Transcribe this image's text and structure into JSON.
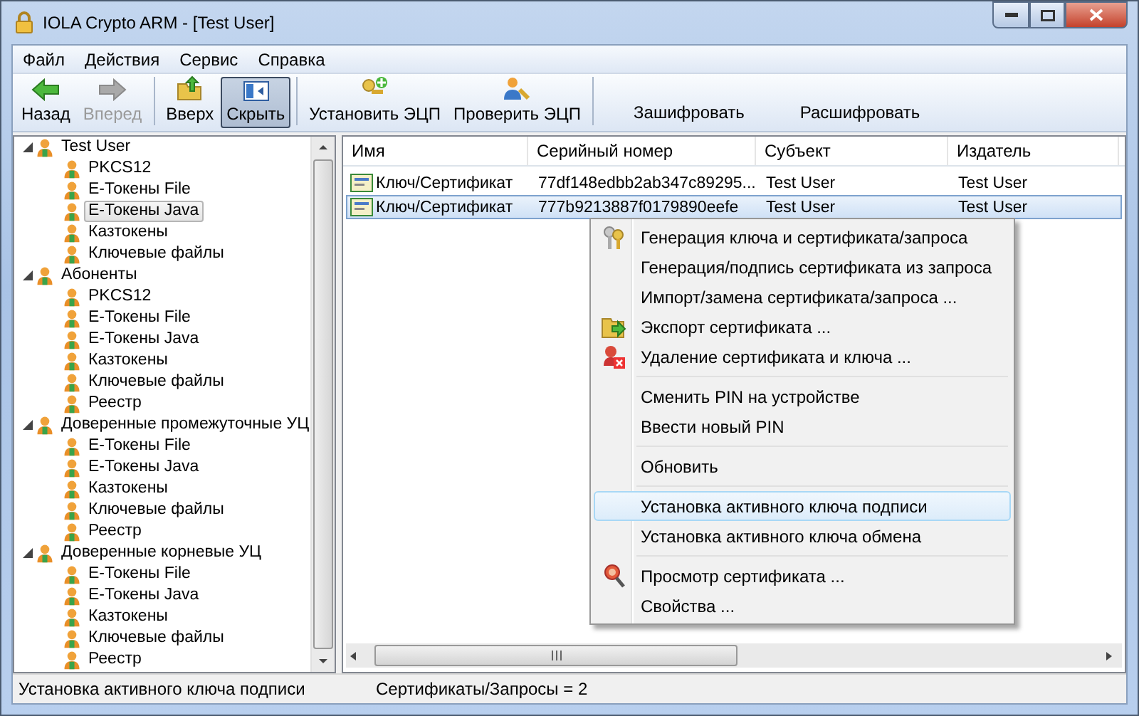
{
  "window": {
    "title": "IOLA Crypto ARM - [Test User]"
  },
  "menu": [
    "Файл",
    "Действия",
    "Сервис",
    "Справка"
  ],
  "toolbar": [
    {
      "label": "Назад",
      "kind": "button",
      "disabled": false,
      "pressed": false
    },
    {
      "label": "Вперед",
      "kind": "button",
      "disabled": true,
      "pressed": false
    },
    {
      "kind": "separator"
    },
    {
      "label": "Вверх",
      "kind": "button",
      "disabled": false,
      "pressed": false
    },
    {
      "label": "Скрыть",
      "kind": "button",
      "disabled": false,
      "pressed": true
    },
    {
      "kind": "separator"
    },
    {
      "label": "Установить ЭЦП",
      "kind": "button",
      "disabled": false,
      "pressed": false
    },
    {
      "label": "Проверить ЭЦП",
      "kind": "button",
      "disabled": false,
      "pressed": false
    },
    {
      "kind": "separator"
    },
    {
      "label": "Зашифровать",
      "kind": "text"
    },
    {
      "label": "Расшифровать",
      "kind": "text"
    }
  ],
  "tree": [
    {
      "label": "Test User",
      "expanded": true,
      "selected": false,
      "children": [
        {
          "label": "PKCS12",
          "selected": false
        },
        {
          "label": "E-Токены File",
          "selected": false
        },
        {
          "label": "E-Токены Java",
          "selected": true
        },
        {
          "label": "Казтокены",
          "selected": false
        },
        {
          "label": "Ключевые файлы",
          "selected": false
        }
      ]
    },
    {
      "label": "Абоненты",
      "expanded": true,
      "selected": false,
      "children": [
        {
          "label": "PKCS12",
          "selected": false
        },
        {
          "label": "E-Токены File",
          "selected": false
        },
        {
          "label": "E-Токены Java",
          "selected": false
        },
        {
          "label": "Казтокены",
          "selected": false
        },
        {
          "label": "Ключевые файлы",
          "selected": false
        },
        {
          "label": "Реестр",
          "selected": false
        }
      ]
    },
    {
      "label": "Доверенные промежуточные УЦ",
      "expanded": true,
      "selected": false,
      "children": [
        {
          "label": "E-Токены File",
          "selected": false
        },
        {
          "label": "E-Токены Java",
          "selected": false
        },
        {
          "label": "Казтокены",
          "selected": false
        },
        {
          "label": "Ключевые файлы",
          "selected": false
        },
        {
          "label": "Реестр",
          "selected": false
        }
      ]
    },
    {
      "label": "Доверенные корневые УЦ",
      "expanded": true,
      "selected": false,
      "children": [
        {
          "label": "E-Токены File",
          "selected": false
        },
        {
          "label": "E-Токены Java",
          "selected": false
        },
        {
          "label": "Казтокены",
          "selected": false
        },
        {
          "label": "Ключевые файлы",
          "selected": false
        },
        {
          "label": "Реестр",
          "selected": false
        }
      ]
    }
  ],
  "table": {
    "columns": [
      "Имя",
      "Серийный номер",
      "Субъект",
      "Издатель"
    ],
    "rows": [
      {
        "selected": false,
        "cells": [
          "Ключ/Сертификат",
          "77df148edbb2ab347c89295...",
          "Test User",
          "Test User"
        ]
      },
      {
        "selected": true,
        "cells": [
          "Ключ/Сертификат",
          "777b9213887f0179890eefe",
          "Test User",
          "Test User"
        ]
      }
    ]
  },
  "context_menu": [
    {
      "kind": "item",
      "label": "Генерация ключа и сертификата/запроса",
      "selected": false
    },
    {
      "kind": "item",
      "label": "Генерация/подпись сертификата из запроса",
      "selected": false
    },
    {
      "kind": "item",
      "label": "Импорт/замена сертификата/запроса ...",
      "selected": false
    },
    {
      "kind": "item",
      "label": "Экспорт сертификата ...",
      "selected": false
    },
    {
      "kind": "item",
      "label": "Удаление сертификата и ключа ...",
      "selected": false
    },
    {
      "kind": "separator"
    },
    {
      "kind": "item",
      "label": "Сменить PIN на устройстве",
      "selected": false
    },
    {
      "kind": "item",
      "label": "Ввести новый PIN",
      "selected": false
    },
    {
      "kind": "separator"
    },
    {
      "kind": "item",
      "label": "Обновить",
      "selected": false
    },
    {
      "kind": "separator"
    },
    {
      "kind": "item",
      "label": "Установка активного ключа подписи",
      "selected": true
    },
    {
      "kind": "item",
      "label": "Установка активного ключа обмена",
      "selected": false
    },
    {
      "kind": "separator"
    },
    {
      "kind": "item",
      "label": "Просмотр сертификата ...",
      "selected": false
    },
    {
      "kind": "item",
      "label": "Свойства ...",
      "selected": false
    }
  ],
  "status_bar": [
    "Установка активного ключа подписи",
    "Сертификаты/Запросы = 2"
  ]
}
